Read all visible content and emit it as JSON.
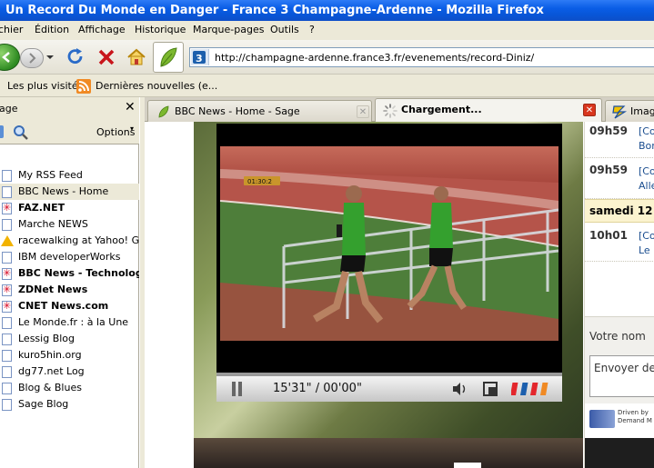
{
  "window": {
    "title": "Un Record Du Monde en Danger - France 3 Champagne-Ardenne - Mozilla Firefox"
  },
  "menu": {
    "items": [
      {
        "label": "chier"
      },
      {
        "label": "Édition"
      },
      {
        "label": "Affichage"
      },
      {
        "label": "Historique"
      },
      {
        "label": "Marque-pages"
      },
      {
        "label": "Outils"
      },
      {
        "label": "?"
      }
    ]
  },
  "navbar": {
    "url": "http://champagne-ardenne.france3.fr/evenements/record-Diniz/",
    "icons": [
      "back-icon",
      "forward-icon",
      "reload-icon",
      "stop-icon",
      "home-icon",
      "leaf-icon"
    ]
  },
  "bookmarks": {
    "items": [
      {
        "label": "Les plus visités"
      },
      {
        "label": "Dernières nouvelles (e..."
      }
    ]
  },
  "sidebar": {
    "title": "age",
    "options_label": "Options",
    "items": [
      {
        "label": "My RSS Feed",
        "bold": false,
        "icon": "page"
      },
      {
        "label": "BBC News - Home",
        "bold": false,
        "icon": "page",
        "selected": true
      },
      {
        "label": "FAZ.NET",
        "bold": true,
        "icon": "star"
      },
      {
        "label": "Marche NEWS",
        "bold": false,
        "icon": "page"
      },
      {
        "label": "racewalking at Yahoo! Gr...",
        "bold": false,
        "icon": "warn"
      },
      {
        "label": "IBM developerWorks",
        "bold": false,
        "icon": "page"
      },
      {
        "label": "BBC News - Technology",
        "bold": true,
        "icon": "star"
      },
      {
        "label": "ZDNet News",
        "bold": true,
        "icon": "star"
      },
      {
        "label": "CNET News.com",
        "bold": true,
        "icon": "star"
      },
      {
        "label": "Le Monde.fr : à la Une",
        "bold": false,
        "icon": "page"
      },
      {
        "label": "Lessig Blog",
        "bold": false,
        "icon": "page"
      },
      {
        "label": "kuro5hin.org",
        "bold": false,
        "icon": "page"
      },
      {
        "label": "dg77.net Log",
        "bold": false,
        "icon": "page"
      },
      {
        "label": "Blog & Blues",
        "bold": false,
        "icon": "page"
      },
      {
        "label": "Sage Blog",
        "bold": false,
        "icon": "page"
      }
    ]
  },
  "tabs": [
    {
      "label": "BBC News - Home - Sage",
      "active": false
    },
    {
      "label": "Chargement...",
      "active": true
    },
    {
      "label": "Image",
      "active": false
    }
  ],
  "player": {
    "overlay_time": "01:30:2",
    "time_display": "15'31\" / 00'00\""
  },
  "right_column": {
    "rows": [
      {
        "time": "09h59",
        "lines": [
          "[Co",
          "Bor"
        ]
      },
      {
        "time": "09h59",
        "lines": [
          "[Co",
          "Alle"
        ]
      },
      {
        "time": "10h01",
        "lines": [
          "[Co",
          "Le"
        ]
      }
    ],
    "date": "samedi 12",
    "name_label": "Votre nom",
    "send_label": "Envoyer de",
    "dm_logo": "Driven by Demand M"
  },
  "colors": {
    "titlebar": "#0A5DE6",
    "chrome": "#ECE9D8",
    "link": "#1A4D8F",
    "track": "#B5544A",
    "jersey": "#34A02E"
  }
}
